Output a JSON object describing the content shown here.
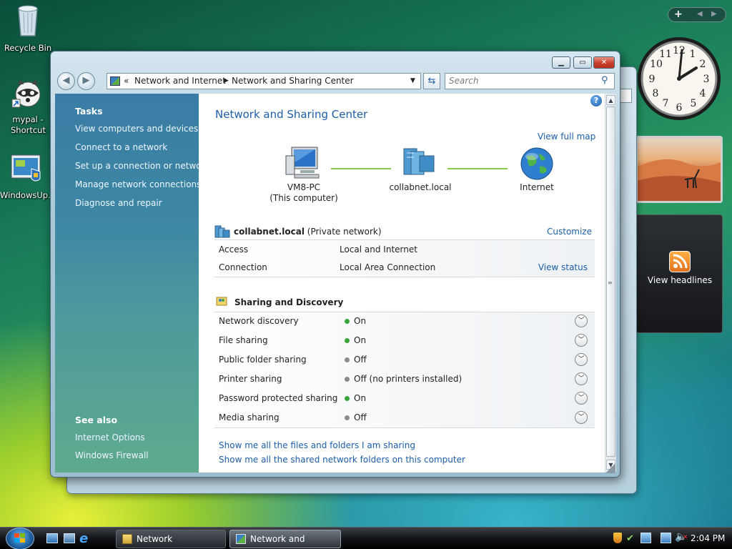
{
  "desktop": {
    "icons": [
      {
        "label": "Recycle Bin"
      },
      {
        "label": "mypal - Shortcut"
      },
      {
        "label": "WindowsUp..."
      }
    ]
  },
  "window": {
    "address": {
      "segment1": "Network and Internet",
      "segment2": "Network and Sharing Center"
    },
    "search_placeholder": "Search",
    "sidebar": {
      "tasks_heading": "Tasks",
      "tasks": [
        "View computers and devices",
        "Connect to a network",
        "Set up a connection or network",
        "Manage network connections",
        "Diagnose and repair"
      ],
      "see_also_heading": "See also",
      "see_also": [
        "Internet Options",
        "Windows Firewall"
      ]
    },
    "title": "Network and Sharing Center",
    "view_full_map": "View full map",
    "map": {
      "computer_name": "VM8-PC",
      "computer_sub": "(This computer)",
      "network_name": "collabnet.local",
      "internet_label": "Internet"
    },
    "network": {
      "name": "collabnet.local",
      "type": "(Private network)",
      "customize": "Customize",
      "access_label": "Access",
      "access_value": "Local and Internet",
      "connection_label": "Connection",
      "connection_value": "Local Area Connection",
      "view_status": "View status"
    },
    "sharing": {
      "heading": "Sharing and Discovery",
      "rows": [
        {
          "label": "Network discovery",
          "value": "On",
          "status_color": "#3aa53a"
        },
        {
          "label": "File sharing",
          "value": "On",
          "status_color": "#3aa53a"
        },
        {
          "label": "Public folder sharing",
          "value": "Off",
          "status_color": "#8a8a8a"
        },
        {
          "label": "Printer sharing",
          "value": "Off (no printers installed)",
          "status_color": "#8a8a8a"
        },
        {
          "label": "Password protected sharing",
          "value": "On",
          "status_color": "#3aa53a"
        },
        {
          "label": "Media sharing",
          "value": "Off",
          "status_color": "#8a8a8a"
        }
      ]
    },
    "bottom_links": [
      "Show me all the files and folders I am sharing",
      "Show me all the shared network folders on this computer"
    ]
  },
  "gadgets": {
    "feed_label": "View headlines"
  },
  "taskbar": {
    "buttons": [
      {
        "label": "Network"
      },
      {
        "label": "Network and Sharin..."
      }
    ],
    "clock": "2:04 PM"
  },
  "colors": {
    "accent_link": "#1d5ea8",
    "sidebar": "#3d88a4",
    "title": "#1d5ea8"
  }
}
